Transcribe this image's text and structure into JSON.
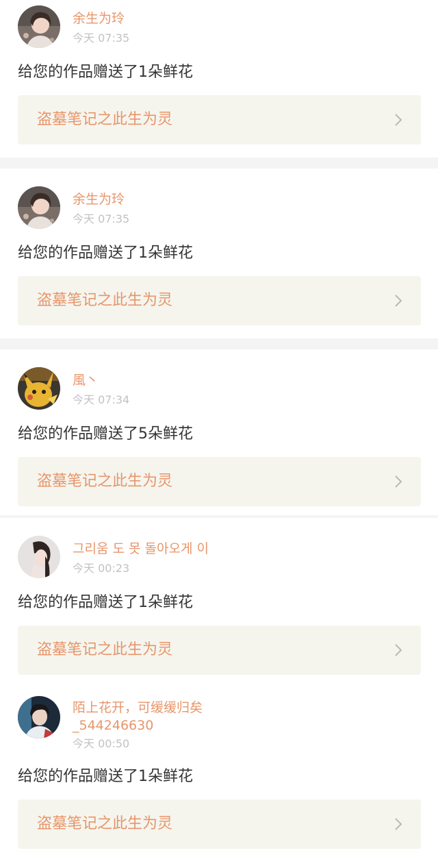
{
  "colors": {
    "accent": "#e7956a",
    "time": "#c2c2c2",
    "link_bg": "#f5f5ee",
    "divider": "#f4f4f4"
  },
  "notifications": [
    {
      "username": "余生为玲",
      "time": "今天 07:35",
      "message": "给您的作品赠送了1朵鲜花",
      "work_title": "盗墓笔记之此生为灵",
      "avatar_icon": "avatar-girl-portrait"
    },
    {
      "username": "余生为玲",
      "time": "今天 07:35",
      "message": "给您的作品赠送了1朵鲜花",
      "work_title": "盗墓笔记之此生为灵",
      "avatar_icon": "avatar-girl-portrait"
    },
    {
      "username": "風丶",
      "time": "今天 07:34",
      "message": "给您的作品赠送了5朵鲜花",
      "work_title": "盗墓笔记之此生为灵",
      "avatar_icon": "avatar-yellow-creature"
    },
    {
      "username": "그리움 도 못 돌아오게 이",
      "time": "今天 00:23",
      "message": "给您的作品赠送了1朵鲜花",
      "work_title": "盗墓笔记之此生为灵",
      "avatar_icon": "avatar-girl-profile"
    },
    {
      "username_line1": "陌上花开，可缓缓归矣",
      "username_line2": "_544246630",
      "time": "今天 00:50",
      "message": "给您的作品赠送了1朵鲜花",
      "work_title": "盗墓笔记之此生为灵",
      "avatar_icon": "avatar-boy-portrait"
    }
  ]
}
